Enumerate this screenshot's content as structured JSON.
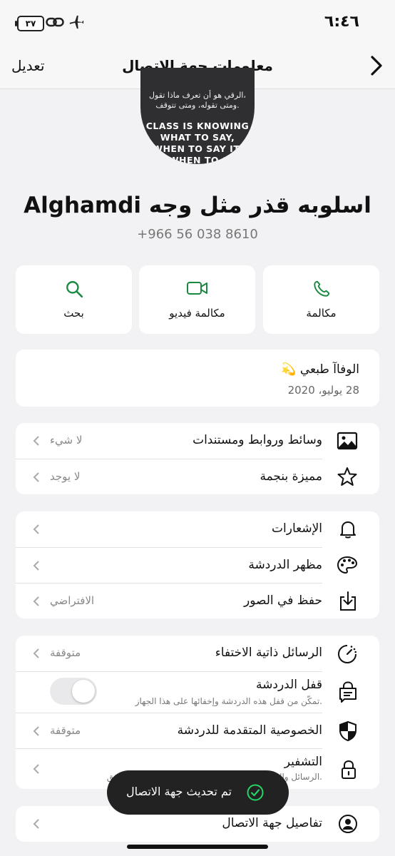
{
  "status": {
    "time": "٦:٤٦",
    "battery": "٣٧"
  },
  "nav": {
    "title": "معلومات جهة الاتصال",
    "edit": "تعديل"
  },
  "avatar": {
    "quote_ar_1": "الرقي هو أن تعرف ماذا تقول،",
    "quote_ar_2": "ومتى تقوله، ومتى تتوقف.",
    "quote_en_1": "CLASS IS KNOWING",
    "quote_en_2": "WHAT TO SAY,",
    "quote_en_3": "WHEN TO SAY IT,",
    "quote_en_4": "AND WHEN TO STOP."
  },
  "contact": {
    "name": "اسلوبه قذر مثل وجه Alghamdi",
    "phone": "+966 56 038 8610"
  },
  "actions": {
    "call": "مكالمة",
    "video": "مكالمة فيديو",
    "search": "بحث"
  },
  "about": {
    "text": "الوفاآ طبعي 💫",
    "date": "28 يوليو، 2020"
  },
  "media": {
    "label": "وسائط وروابط ومستندات",
    "value": "لا شيء"
  },
  "starred": {
    "label": "مميزة بنجمة",
    "value": "لا يوجد"
  },
  "notifications": {
    "label": "الإشعارات"
  },
  "chat_theme": {
    "label": "مظهر الدردشة"
  },
  "save_photos": {
    "label": "حفظ في الصور",
    "value": "الافتراضي"
  },
  "disappearing": {
    "label": "الرسائل ذاتية الاختفاء",
    "value": "متوقفة"
  },
  "chat_lock": {
    "label": "قفل الدردشة",
    "sub": "تمكّن من قفل هذه الدردشة وإخفائها على هذا الجهاز."
  },
  "privacy": {
    "label": "الخصوصية المتقدمة للدردشة",
    "value": "متوقفة"
  },
  "encryption": {
    "label": "التشفير",
    "sub": "الرسائل والمكالمات مشفرة تمامًا بين الطرفين. انقر للتحقق."
  },
  "contact_details": {
    "label": "تفاصيل جهة الاتصال"
  },
  "toast": {
    "text": "تم تحديث جهة الاتصال"
  },
  "colors": {
    "accent": "#1a8a42",
    "background": "#f2f2f4"
  }
}
